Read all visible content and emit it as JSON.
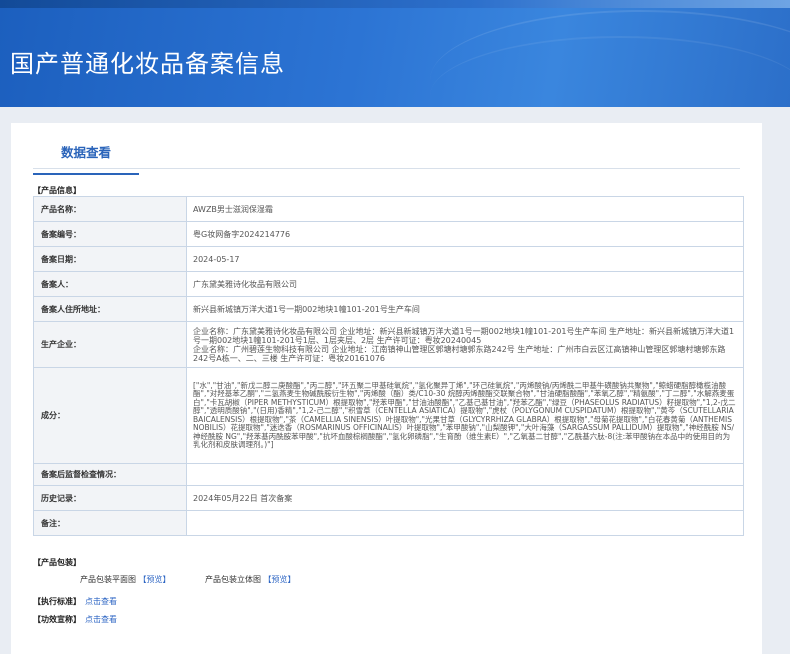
{
  "page": {
    "title": "国产普通化妆品备案信息"
  },
  "tab": {
    "label": "数据查看"
  },
  "product_info": {
    "section_label": "【产品信息】",
    "rows": [
      {
        "key": "产品名称：",
        "value": "AWZB男士滋润保湿霜"
      },
      {
        "key": "备案编号：",
        "value": "粤G妆网备字2024214776"
      },
      {
        "key": "备案日期：",
        "value": "2024-05-17"
      },
      {
        "key": "备案人：",
        "value": "广东黛美雅诗化妆品有限公司"
      },
      {
        "key": "备案人住所地址：",
        "value": "新兴县新城镇万洋大道1号一期002地块1幢101-201号生产车间"
      },
      {
        "key": "生产企业：",
        "value": "企业名称：广东黛美雅诗化妆品有限公司 企业地址：新兴县新城镇万洋大道1号一期002地块1幢101-201号生产车间 生产地址：新兴县新城镇万洋大道1号一期002地块1幢101-201号1层、1层夹层、2层 生产许可证：粤妆20240045\n企业名称：广州碧莲生物科技有限公司 企业地址：江南镇神山管理区郭塘村塘郭东路242号 生产地址：广州市白云区江高镇神山管理区郭塘村塘郭东路242号A栋一、二、三楼 生产许可证：粤妆20161076"
      },
      {
        "key": "成分：",
        "value": "[\"水\",\"甘油\",\"新戊二醇二庚酸酯\",\"丙二醇\",\"环五聚二甲基硅氧烷\",\"氢化聚异丁烯\",\"环己硅氧烷\",\"丙烯酸钠/丙烯酰二甲基牛磺酸钠共聚物\",\"鲸蜡硬脂醇橄榄油酸酯\",\"对羟基苯乙酮\",\"二氢燕麦生物碱酰胺衍生物\",\"丙烯酸（酯）类/C10-30 烷醇丙烯酸酯交联聚合物\",\"甘油硬脂酸酯\",\"苯氧乙醇\",\"精氨酸\",\"丁二醇\",\"水解燕麦蛋白\",\"卡瓦胡椒（PIPER METHYSTICUM）根提取物\",\"羟苯甲酯\",\"甘油油酸酯\",\"乙基己基甘油\",\"羟苯乙酯\",\"绿豆（PHASEOLUS RADIATUS）籽提取物\",\"1,2-戊二醇\",\"透明质酸钠\",\"(日用)香精\",\"1,2-己二醇\",\"积雪草（CENTELLA ASIATICA）提取物\",\"虎杖（POLYGONUM CUSPIDATUM）根提取物\",\"黄芩（SCUTELLARIA BAICALENSIS）根提取物\",\"茶（CAMELLIA SINENSIS）叶提取物\",\"光果甘草（GLYCYRRHIZA GLABRA）根提取物\",\"母菊花提取物\",\"白花春黄菊（ANTHEMIS NOBILIS）花提取物\",\"迷迭香（ROSMARINUS OFFICINALIS）叶提取物\",\"苯甲酸钠\",\"山梨酸钾\",\"大叶海藻（SARGASSUM PALLIDUM）提取物\",\"神经酰胺 NS/神经酰胺 NG\",\"羟苯基丙酰胺苯甲酸\",\"抗坏血酸棕榈酸酯\",\"氢化卵磷脂\",\"生育酚（维生素E）\",\"乙氧基二甘醇\",\"乙酰基六肽-8(注:苯甲酸钠在本品中的使用目的为乳化剂和皮肤调理剂。)\"]"
      },
      {
        "key": "备案后监督检查情况：",
        "value": ""
      },
      {
        "key": "历史记录：",
        "value": "2024年05月22日 首次备案"
      },
      {
        "key": "备注：",
        "value": ""
      }
    ]
  },
  "packaging": {
    "section_label": "【产品包装】",
    "flat_label": "产品包装平面图",
    "flat_link": "【预览】",
    "three_d_label": "产品包装立体图",
    "three_d_link": "【预览】"
  },
  "standard": {
    "label": "【执行标准】",
    "link": "点击查看"
  },
  "claims": {
    "label": "【功效宣称】",
    "link": "点击查看"
  },
  "colors": {
    "banner": "#2c74d4",
    "accent": "#2a64ba",
    "link": "#2e66c4"
  }
}
